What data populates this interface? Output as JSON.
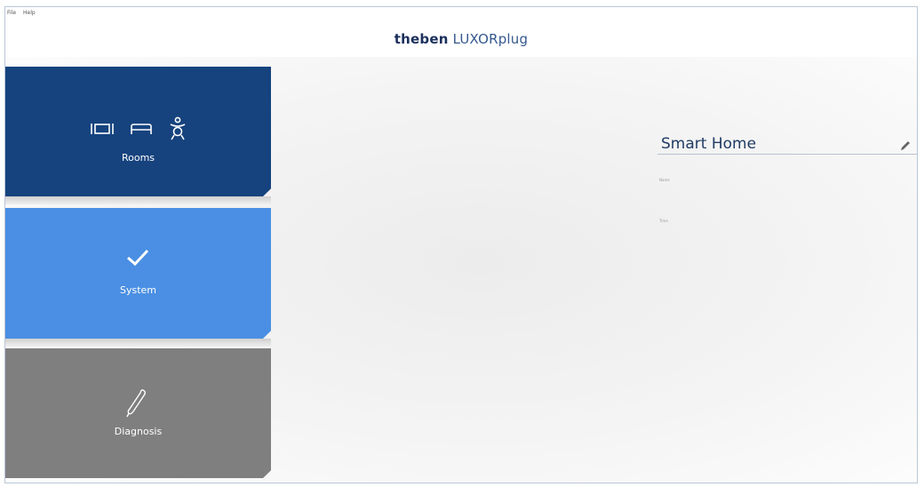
{
  "menu": {
    "file": "File",
    "help": "Help"
  },
  "brand": {
    "name": "theben",
    "product": "LUXORplug"
  },
  "tiles": {
    "rooms": {
      "label": "Rooms",
      "color": "#16437e"
    },
    "system": {
      "label": "System",
      "color": "#4a8fe3"
    },
    "diagnosis": {
      "label": "Diagnosis",
      "color": "#7f7f7f"
    }
  },
  "panel": {
    "title": "Smart Home",
    "field1_label": "Name",
    "field2_label": "Time"
  },
  "icons": {
    "rooms": [
      "tv-icon",
      "bed-icon",
      "child-icon"
    ],
    "system": "checkmark-icon",
    "diagnosis": "probe-icon",
    "edit": "pencil-icon"
  }
}
